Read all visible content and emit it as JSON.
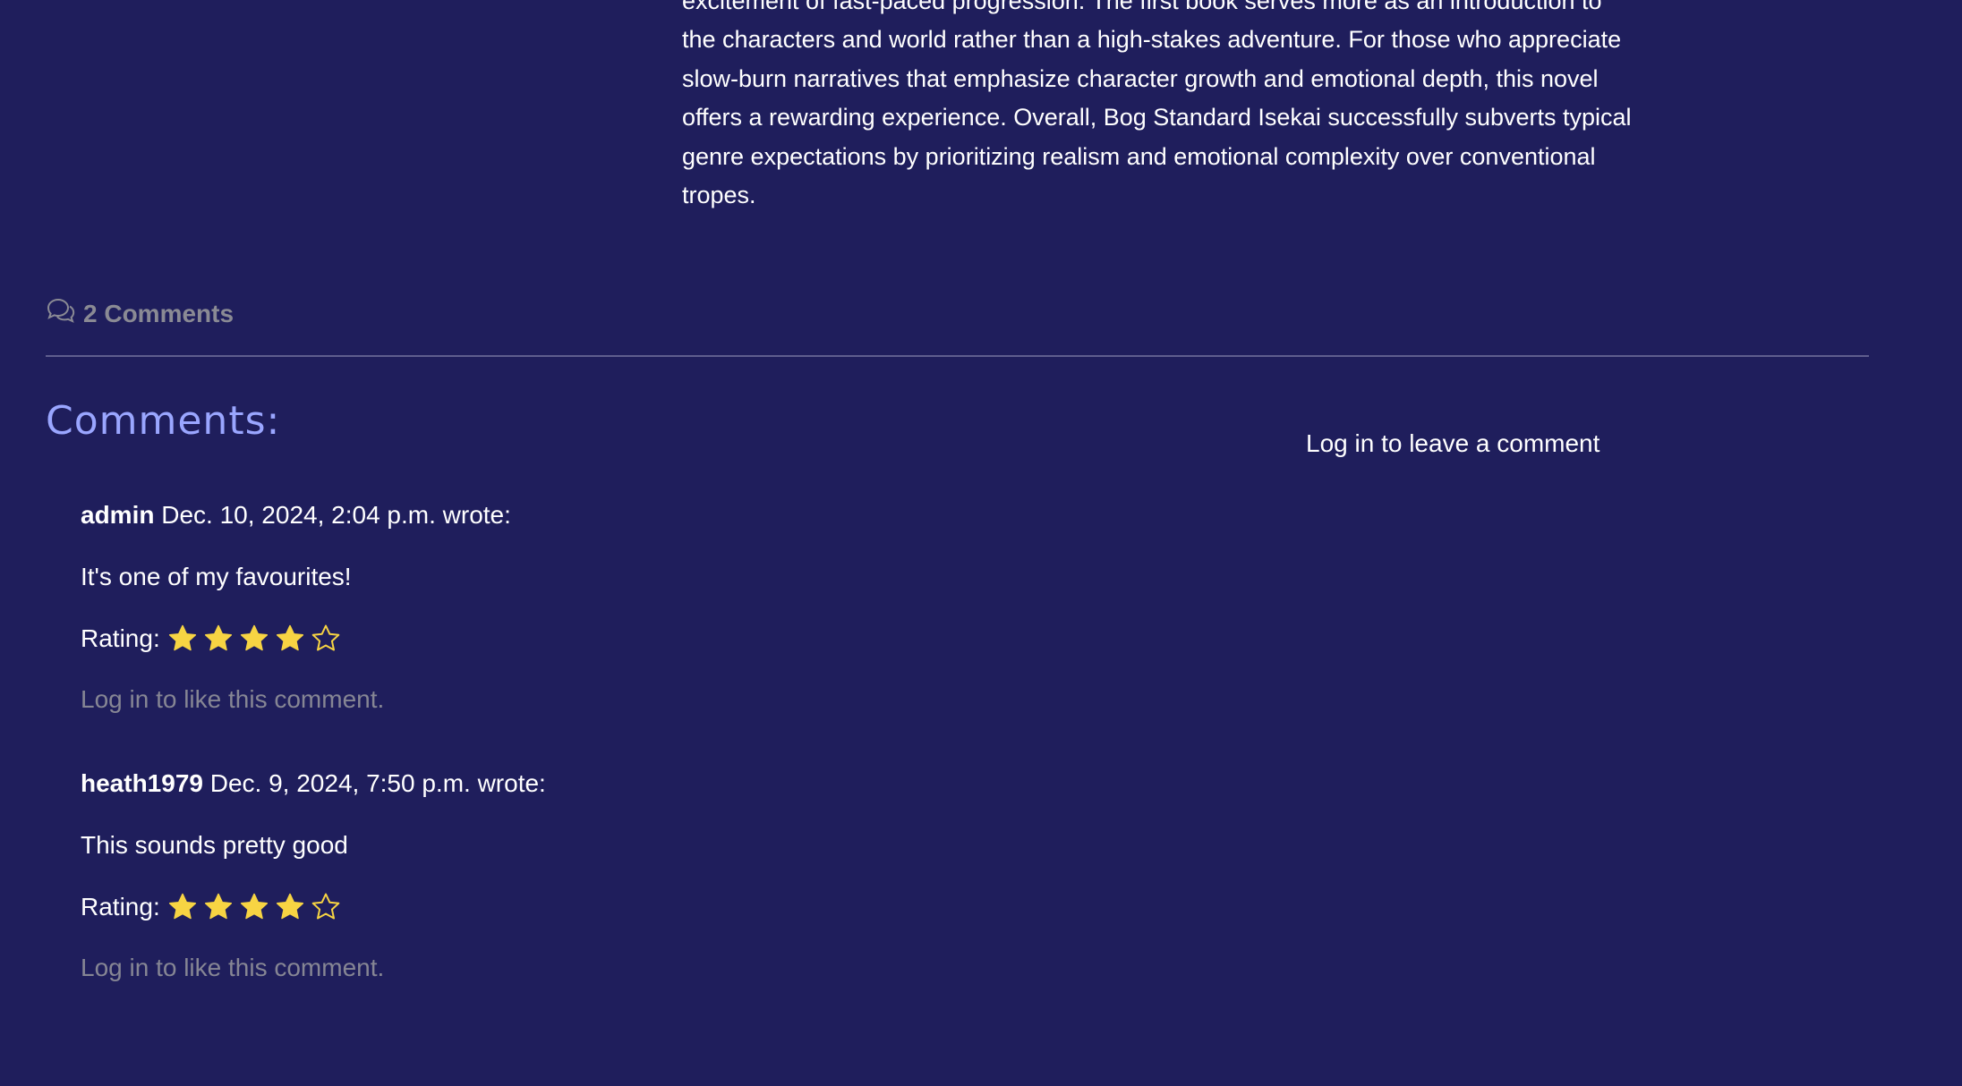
{
  "review": {
    "lines": [
      "excitement of fast-paced progression. The first book serves more as an introduction to",
      "the characters and world rather than a high-stakes adventure. For those who appreciate",
      "slow-burn narratives that emphasize character growth and emotional depth, this novel",
      "offers a rewarding experience. Overall, Bog Standard Isekai successfully subverts typical",
      "genre expectations by prioritizing realism and emotional complexity over conventional",
      "tropes."
    ]
  },
  "comments_section": {
    "count_label": "2 Comments",
    "heading": "Comments:",
    "login_prompt": "Log in to leave a comment",
    "colors": {
      "background": "#1f1e5c",
      "heading": "#9aa6ff",
      "muted": "#868694",
      "star": "#f7d443"
    },
    "comments": [
      {
        "author": "admin",
        "date": "Dec. 10, 2024, 2:04 p.m. wrote:",
        "body": "It's one of my favourites!",
        "rating_label": "Rating:",
        "rating": 4,
        "rating_max": 5,
        "like_prompt": "Log in to like this comment."
      },
      {
        "author": "heath1979",
        "date": "Dec. 9, 2024, 7:50 p.m. wrote:",
        "body": "This sounds pretty good",
        "rating_label": "Rating:",
        "rating": 4,
        "rating_max": 5,
        "like_prompt": "Log in to like this comment."
      }
    ]
  }
}
